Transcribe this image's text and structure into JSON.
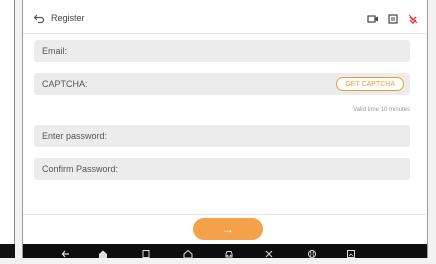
{
  "header": {
    "title": "Register",
    "icons": [
      "back-arrow-icon",
      "video-icon",
      "screenshot-icon",
      "vci-disconnected-icon"
    ]
  },
  "form": {
    "email_placeholder": "Email:",
    "captcha_placeholder": "CAPTCHA:",
    "get_captcha_label": "GET CAPTCHA",
    "valid_time": "Valid time 10 minutes",
    "password_placeholder": "Enter password:",
    "confirm_password_placeholder": "Confirm Password:"
  },
  "next_button": {
    "label": "→"
  },
  "navbar": {
    "icons": [
      "back-icon",
      "home-icon",
      "recent-apps-icon",
      "home-outline-icon",
      "car-icon",
      "tools-icon",
      "browser-icon",
      "gallery-icon"
    ]
  },
  "colors": {
    "accent": "#f5a14a",
    "field_bg": "#ececec",
    "navbar_bg": "#0d0d0d",
    "vci_status": "#e0413a"
  }
}
